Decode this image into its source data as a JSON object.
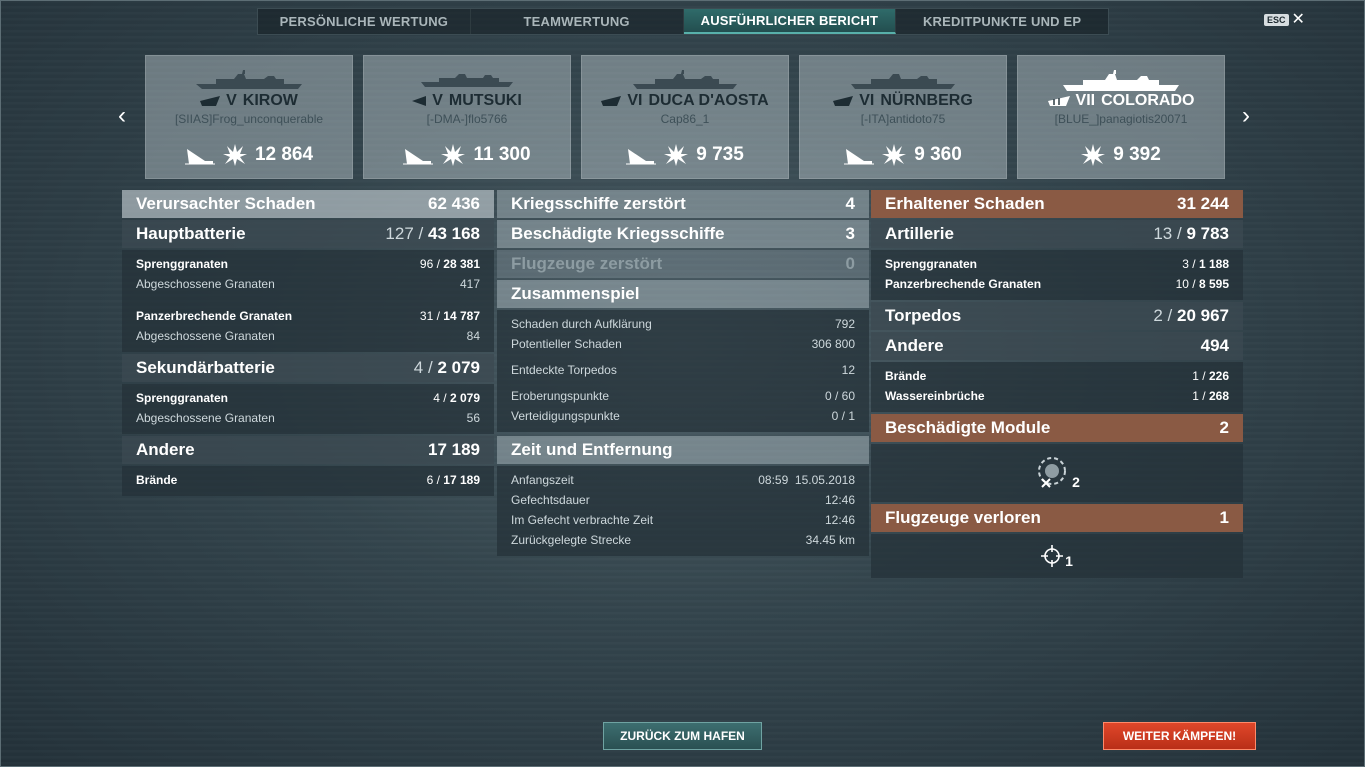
{
  "tabs": [
    {
      "label": "PERSÖNLICHE WERTUNG"
    },
    {
      "label": "TEAMWERTUNG"
    },
    {
      "label": "AUSFÜHRLICHER BERICHT"
    },
    {
      "label": "KREDITPUNKTE UND EP"
    }
  ],
  "esc": {
    "key": "ESC",
    "close": "✕"
  },
  "nav": {
    "prev": "‹",
    "next": "›"
  },
  "ships": [
    {
      "tier": "V",
      "name": "KIROW",
      "player": "[SIIAS]Frog_unconquerable",
      "score": "12 864",
      "icons": [
        "ship-sunk-icon",
        "damage-burst-icon"
      ]
    },
    {
      "tier": "V",
      "name": "MUTSUKI",
      "player": "[-DMA-]flo5766",
      "score": "11 300",
      "icons": [
        "ship-sunk-icon",
        "damage-burst-icon"
      ]
    },
    {
      "tier": "VI",
      "name": "DUCA D'AOSTA",
      "player": "Cap86_1",
      "score": "9 735",
      "icons": [
        "ship-sunk-icon",
        "damage-burst-icon"
      ]
    },
    {
      "tier": "VI",
      "name": "NÜRNBERG",
      "player": "[-ITA]antidoto75",
      "score": "9 360",
      "icons": [
        "ship-sunk-icon",
        "damage-burst-icon"
      ]
    },
    {
      "tier": "VII",
      "name": "COLORADO",
      "player": "[BLUE_]panagiotis20071",
      "score": "9 392",
      "icons": [
        "damage-burst-icon"
      ]
    }
  ],
  "col1": {
    "damage": {
      "label": "Verursachter Schaden",
      "value": "62 436"
    },
    "main_battery": {
      "label": "Hauptbatterie",
      "hits": "127",
      "sep": "/",
      "damage": "43 168"
    },
    "he": {
      "label": "Sprenggranaten",
      "hits": "96",
      "sep": "/",
      "damage": "28 381"
    },
    "he_fired": {
      "label": "Abgeschossene Granaten",
      "value": "417"
    },
    "ap": {
      "label": "Panzerbrechende Granaten",
      "hits": "31",
      "sep": "/",
      "damage": "14 787"
    },
    "ap_fired": {
      "label": "Abgeschossene Granaten",
      "value": "84"
    },
    "secondary": {
      "label": "Sekundärbatterie",
      "hits": "4",
      "sep": "/",
      "damage": "2 079"
    },
    "sec_he": {
      "label": "Sprenggranaten",
      "hits": "4",
      "sep": "/",
      "damage": "2 079"
    },
    "sec_fired": {
      "label": "Abgeschossene Granaten",
      "value": "56"
    },
    "other": {
      "label": "Andere",
      "value": "17 189"
    },
    "fires": {
      "label": "Brände",
      "hits": "6",
      "sep": "/",
      "damage": "17 189"
    }
  },
  "col2": {
    "ships_destroyed": {
      "label": "Kriegsschiffe zerstört",
      "value": "4"
    },
    "ships_damaged": {
      "label": "Beschädigte Kriegsschiffe",
      "value": "3"
    },
    "planes_destroyed": {
      "label": "Flugzeuge zerstört",
      "value": "0"
    },
    "teamplay": {
      "label": "Zusammenspiel"
    },
    "spotting": {
      "label": "Schaden durch Aufklärung",
      "value": "792"
    },
    "potential": {
      "label": "Potentieller Schaden",
      "value": "306 800"
    },
    "torps_spotted": {
      "label": "Entdeckte Torpedos",
      "value": "12"
    },
    "capture": {
      "label": "Eroberungspunkte",
      "value": "0 / 60"
    },
    "defense": {
      "label": "Verteidigungspunkte",
      "value": "0 / 1"
    },
    "time": {
      "label": "Zeit und Entfernung"
    },
    "start": {
      "label": "Anfangszeit",
      "value": "08:59  15.05.2018"
    },
    "duration": {
      "label": "Gefechtsdauer",
      "value": "12:46"
    },
    "in_battle": {
      "label": "Im Gefecht verbrachte Zeit",
      "value": "12:46"
    },
    "distance": {
      "label": "Zurückgelegte Strecke",
      "value": "34.45 km"
    }
  },
  "col3": {
    "received": {
      "label": "Erhaltener Schaden",
      "value": "31 244"
    },
    "artillery": {
      "label": "Artillerie",
      "hits": "13",
      "sep": "/",
      "damage": "9 783"
    },
    "he": {
      "label": "Sprenggranaten",
      "hits": "3",
      "sep": "/",
      "damage": "1 188"
    },
    "ap": {
      "label": "Panzerbrechende Granaten",
      "hits": "10",
      "sep": "/",
      "damage": "8 595"
    },
    "torpedoes": {
      "label": "Torpedos",
      "hits": "2",
      "sep": "/",
      "damage": "20 967"
    },
    "other": {
      "label": "Andere",
      "value": "494"
    },
    "fires": {
      "label": "Brände",
      "hits": "1",
      "sep": "/",
      "damage": "226"
    },
    "floods": {
      "label": "Wassereinbrüche",
      "hits": "1",
      "sep": "/",
      "damage": "268"
    },
    "modules": {
      "label": "Beschädigte Module",
      "value": "2",
      "icon_count": "2",
      "icon": "module-damage-icon"
    },
    "planes_lost": {
      "label": "Flugzeuge verloren",
      "value": "1",
      "icon_count": "1",
      "icon": "crosshair-icon"
    }
  },
  "buttons": {
    "port": "ZURÜCK ZUM HAFEN",
    "fight": "WEITER KÄMPFEN!"
  },
  "colors": {
    "accent": "#58b0aa",
    "orange_header": "#8a5a44",
    "fight_button": "#d23e22"
  }
}
